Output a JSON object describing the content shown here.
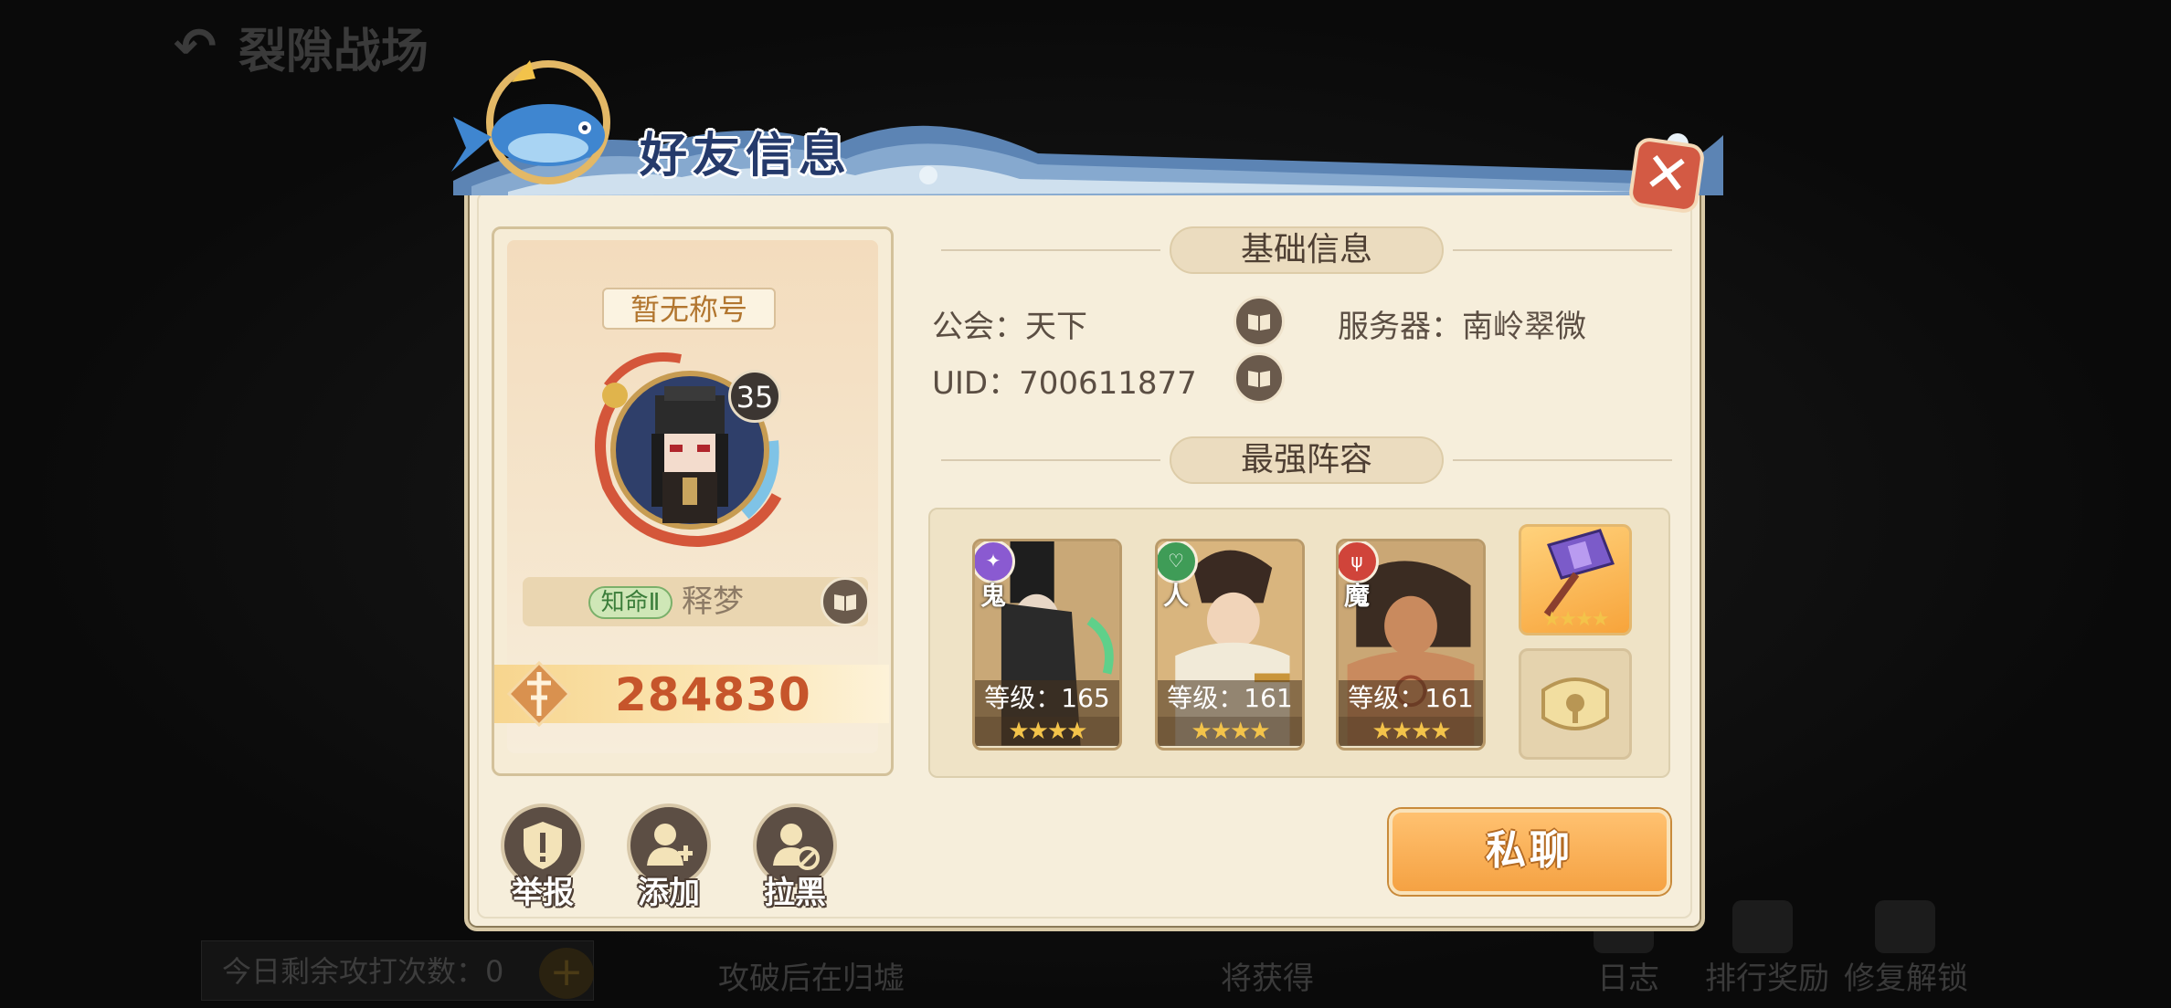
{
  "background": {
    "back_title": "裂隙战场",
    "attempts_label": "今日剩余攻打次数：0",
    "hint_text": "攻破后在归墟",
    "reward_text": "将获得",
    "log_label": "日志",
    "rank_reward_label": "排行奖励",
    "repair_label": "修复解锁"
  },
  "dialog": {
    "title": "好友信息",
    "close_icon": "close-icon"
  },
  "profile": {
    "title_tag": "暂无称号",
    "level": "35",
    "rank_badge": "知命Ⅱ",
    "name": "释梦",
    "power": "284830"
  },
  "basic_info": {
    "header": "基础信息",
    "guild_label": "公会：",
    "guild_value": "天下",
    "uid_label": "UID：",
    "uid_value": "700611877",
    "server_label": "服务器：",
    "server_value": "南岭翠微"
  },
  "lineup": {
    "header": "最强阵容",
    "heroes": [
      {
        "faction": "鬼",
        "level_text": "等级：165",
        "stars": "★★★★",
        "faction_color": "#8a5ad1"
      },
      {
        "faction": "人",
        "level_text": "等级：161",
        "stars": "★★★★",
        "faction_color": "#3f9c57"
      },
      {
        "faction": "魔",
        "level_text": "等级：161",
        "stars": "★★★★",
        "faction_color": "#d0443a"
      }
    ],
    "artifact_stars": "★★★★",
    "locked_icon": "lock-icon"
  },
  "actions": {
    "report_label": "举报",
    "add_label": "添加",
    "block_label": "拉黑"
  },
  "chat_button": "私聊",
  "colors": {
    "accent_orange": "#f5a243",
    "panel_bg": "#f6eedb",
    "power_text": "#c6552b",
    "header_blue": "#253a6b"
  }
}
